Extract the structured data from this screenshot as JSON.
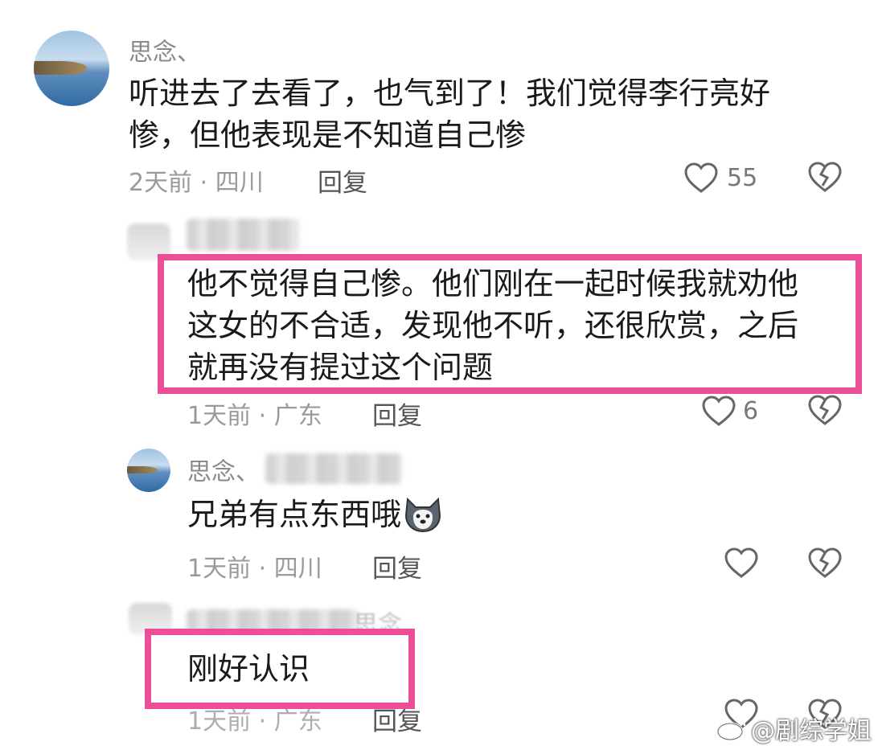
{
  "comments": [
    {
      "author": "思念、",
      "text_lines": [
        "听进去了去看了，也气到了！我们觉得李行亮好",
        "惨，但他表现是不知道自己惨"
      ],
      "time_location": "2天前 · 四川",
      "reply_label": "回复",
      "like_count": "55"
    },
    {
      "text_lines": [
        "他不觉得自己惨。他们刚在一起时候我就劝他",
        "这女的不合适，发现他不听，还很欣赏，之后",
        "就再没有提过这个问题"
      ],
      "time_location": "1天前 · 广东",
      "reply_label": "回复",
      "like_count": "6"
    },
    {
      "author": "思念、",
      "text": "兄弟有点东西哦",
      "emoji": "husky-emoji",
      "time_location": "1天前 · 四川",
      "reply_label": "回复"
    },
    {
      "author_suffix": "思念",
      "text": "刚好认识",
      "time_location": "1天前 · 广东",
      "reply_label": "回复"
    }
  ],
  "watermark": "@剧综学姐",
  "colors": {
    "highlight": "#ec4f98",
    "meta": "#9a9a9a",
    "text": "#1a1a1a"
  },
  "icons": [
    "heart-icon",
    "heart-broken-icon",
    "weibo-logo-icon"
  ]
}
